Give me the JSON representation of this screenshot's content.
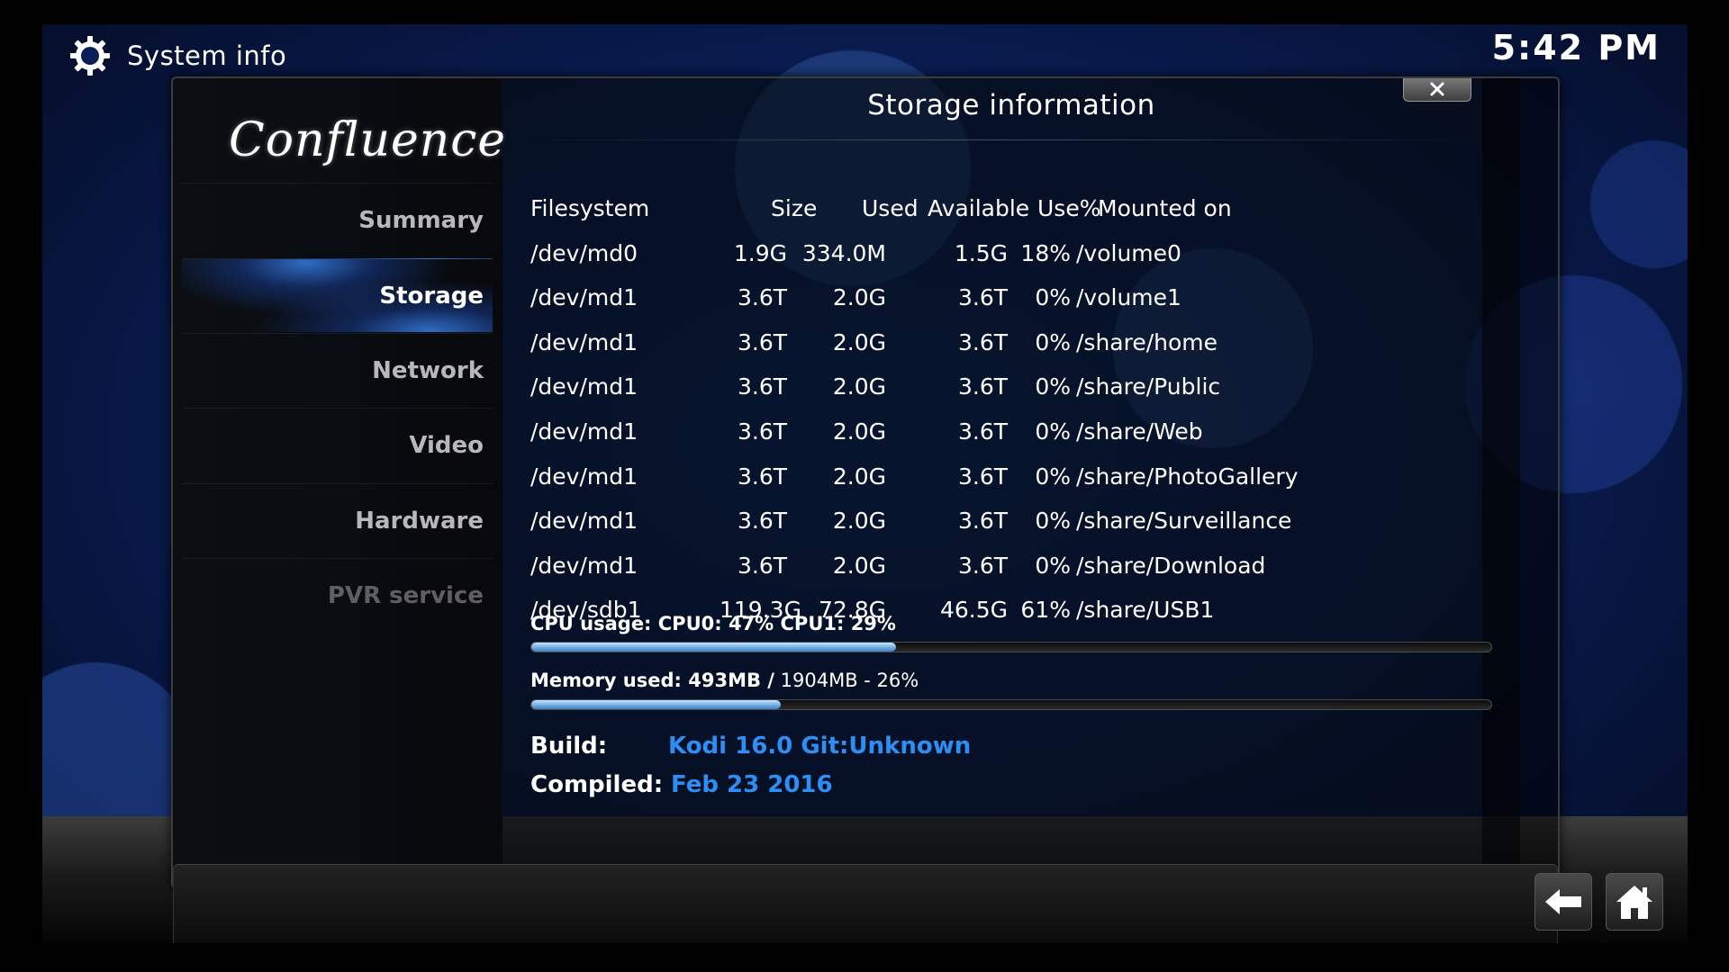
{
  "header": {
    "title": "System info",
    "clock": "5:42 PM"
  },
  "sidebar": {
    "logo": "Confluence",
    "items": [
      {
        "label": "Summary",
        "active": false
      },
      {
        "label": "Storage",
        "active": true
      },
      {
        "label": "Network",
        "active": false
      },
      {
        "label": "Video",
        "active": false
      },
      {
        "label": "Hardware",
        "active": false
      },
      {
        "label": "PVR service",
        "active": false,
        "disabled": true
      }
    ]
  },
  "dialog": {
    "heading": "Storage information"
  },
  "storage": {
    "headers": [
      "Filesystem",
      "Size",
      "Used",
      "Available",
      "Use%",
      "Mounted on"
    ],
    "rows": [
      [
        "/dev/md0",
        "1.9G",
        "334.0M",
        "1.5G",
        "18%",
        "/volume0"
      ],
      [
        "/dev/md1",
        "3.6T",
        "2.0G",
        "3.6T",
        "0%",
        "/volume1"
      ],
      [
        "/dev/md1",
        "3.6T",
        "2.0G",
        "3.6T",
        "0%",
        "/share/home"
      ],
      [
        "/dev/md1",
        "3.6T",
        "2.0G",
        "3.6T",
        "0%",
        "/share/Public"
      ],
      [
        "/dev/md1",
        "3.6T",
        "2.0G",
        "3.6T",
        "0%",
        "/share/Web"
      ],
      [
        "/dev/md1",
        "3.6T",
        "2.0G",
        "3.6T",
        "0%",
        "/share/PhotoGallery"
      ],
      [
        "/dev/md1",
        "3.6T",
        "2.0G",
        "3.6T",
        "0%",
        "/share/Surveillance"
      ],
      [
        "/dev/md1",
        "3.6T",
        "2.0G",
        "3.6T",
        "0%",
        "/share/Download"
      ],
      [
        "/dev/sdb1",
        "119.3G",
        "72.8G",
        "46.5G",
        "61%",
        "/share/USB1"
      ]
    ]
  },
  "cpu": {
    "label": "CPU usage: CPU0:  47% CPU1:  29%",
    "fill_fraction": 0.38
  },
  "memory": {
    "label_bold": "Memory used: 493MB /",
    "label_light": " 1904MB - 26%",
    "fill_fraction": 0.26
  },
  "build": {
    "build_label": "Build:",
    "build_value": "Kodi 16.0 Git:Unknown",
    "compiled_label": "Compiled:",
    "compiled_value": "Feb 23 2016"
  },
  "icons": {
    "title_icon": "gear-icon",
    "close": "close-icon",
    "back": "back-arrow-icon",
    "home": "home-icon"
  },
  "colors": {
    "accent_blue": "#2d8ff5",
    "bar_fill": "#6aa8dc"
  }
}
